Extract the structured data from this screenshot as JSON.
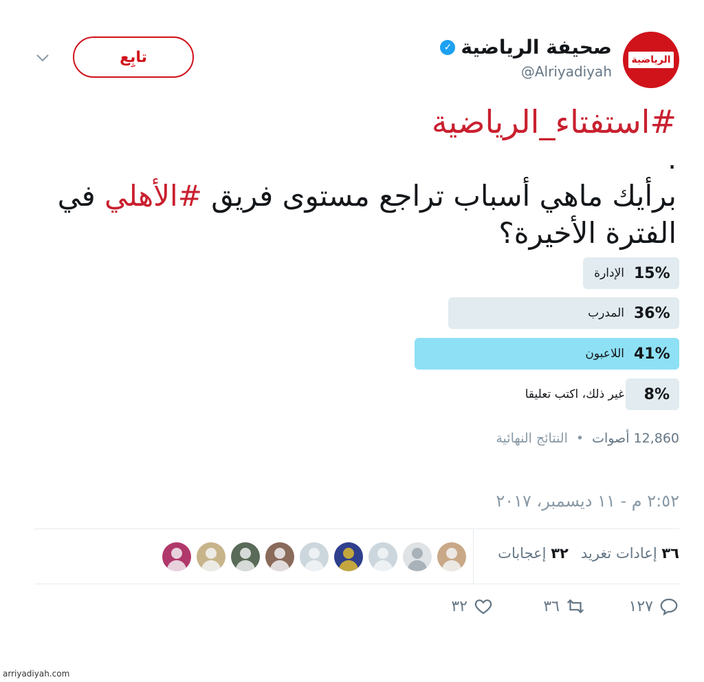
{
  "header": {
    "display_name": "صحيفة الرياضية",
    "handle": "@Alriyadiyah",
    "avatar_text": "الرياضية",
    "follow_label": "تابِع",
    "verified_mark": "✓"
  },
  "tweet": {
    "hashtag_title": "#استفتاء_الرياضية",
    "dot": ".",
    "question_part1": "برأيك ماهي أسباب تراجع مستوى فريق ",
    "question_tag": "#الأهلي",
    "question_part2": " في الفترة الأخيرة؟"
  },
  "poll": {
    "options": [
      {
        "pct": "15%",
        "label": "الإدارة",
        "fraction": 0.15,
        "winner": false
      },
      {
        "pct": "36%",
        "label": "المدرب",
        "fraction": 0.36,
        "winner": false
      },
      {
        "pct": "41%",
        "label": "اللاعبون",
        "fraction": 0.41,
        "winner": true
      },
      {
        "pct": "8%",
        "label": "غير ذلك، اكتب تعليقا",
        "fraction": 0.08,
        "winner": false
      }
    ],
    "votes_text": "12,860 أصوات",
    "separator": "•",
    "status_text": "النتائج النهائية",
    "colors": {
      "winner": "#8ee0f5",
      "other": "#e1ebf0"
    }
  },
  "timestamp": "٢:٥٢ م - ١١ ديسمبر، ٢٠١٧",
  "stats": {
    "retweets_count": "٣٦",
    "retweets_label": "إعادات تغريد",
    "likes_count": "٣٢",
    "likes_label": "إعجابات"
  },
  "actions": {
    "reply_count": "١٢٧",
    "retweet_count": "٣٦",
    "like_count": "٣٢"
  },
  "footer": {
    "url": "arriyadiyah.com"
  }
}
